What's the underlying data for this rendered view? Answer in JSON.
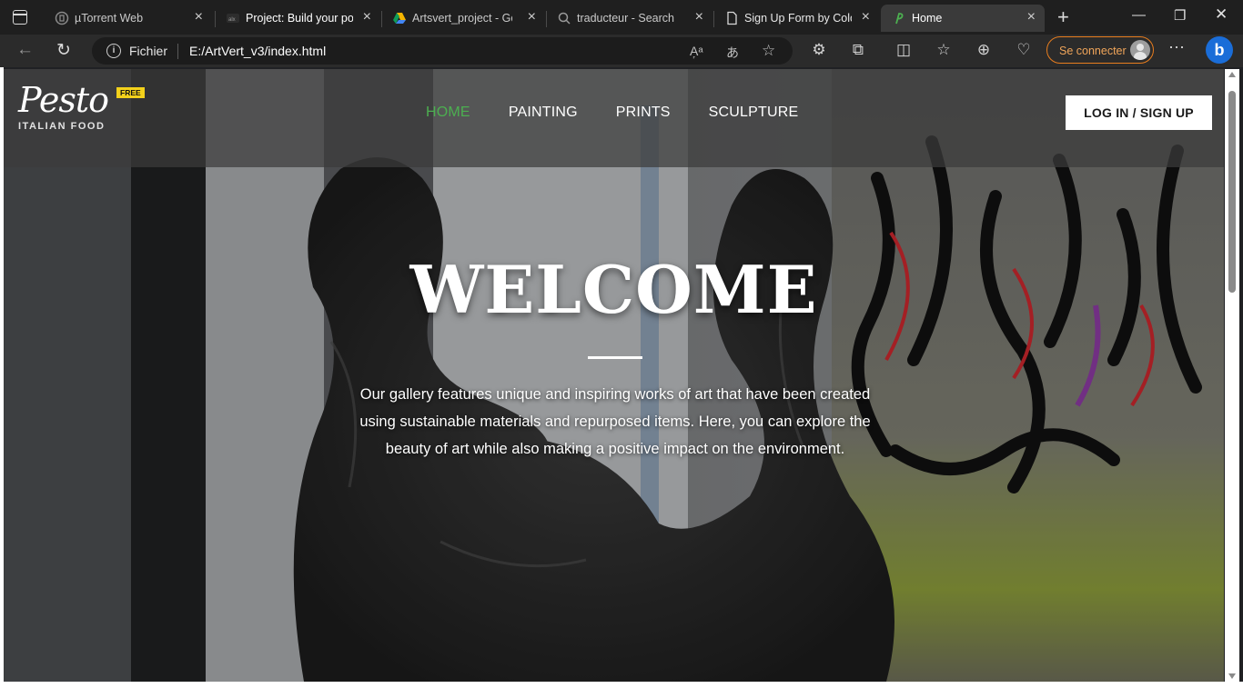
{
  "browser": {
    "tabs": [
      {
        "title": "µTorrent Web",
        "icon": "utorrent-icon",
        "active": false
      },
      {
        "title": "Project: Build your portfolio",
        "icon": "project-icon",
        "active": false
      },
      {
        "title": "Artsvert_project - Google Drive",
        "icon": "google-drive-icon",
        "active": false
      },
      {
        "title": "traducteur - Search",
        "icon": "search-page-icon",
        "active": false
      },
      {
        "title": "Sign Up Form by Colorlib",
        "icon": "page-icon",
        "active": false
      },
      {
        "title": "Home",
        "icon": "pesto-icon",
        "active": true
      }
    ],
    "address_bar": {
      "protocol_label": "Fichier",
      "url": "E:/ArtVert_v3/index.html"
    },
    "sign_in_label": "Se connecter",
    "bing_label": "b",
    "accent_color": "#e87d1e"
  },
  "site": {
    "logo": {
      "name": "Pesto",
      "subtitle": "ITALIAN FOOD",
      "badge": "FREE"
    },
    "nav": {
      "home": "HOME",
      "painting": "PAINTING",
      "prints": "PRINTS",
      "sculpture": "SCULPTURE",
      "active_color": "#4caf50"
    },
    "login_button": "LOG IN / SIGN UP",
    "hero": {
      "title": "WELCOME",
      "text": "Our gallery features unique and inspiring works of art that have been created using sustainable materials and repurposed items. Here, you can explore the beauty of art while also making a positive impact on the environment."
    }
  }
}
